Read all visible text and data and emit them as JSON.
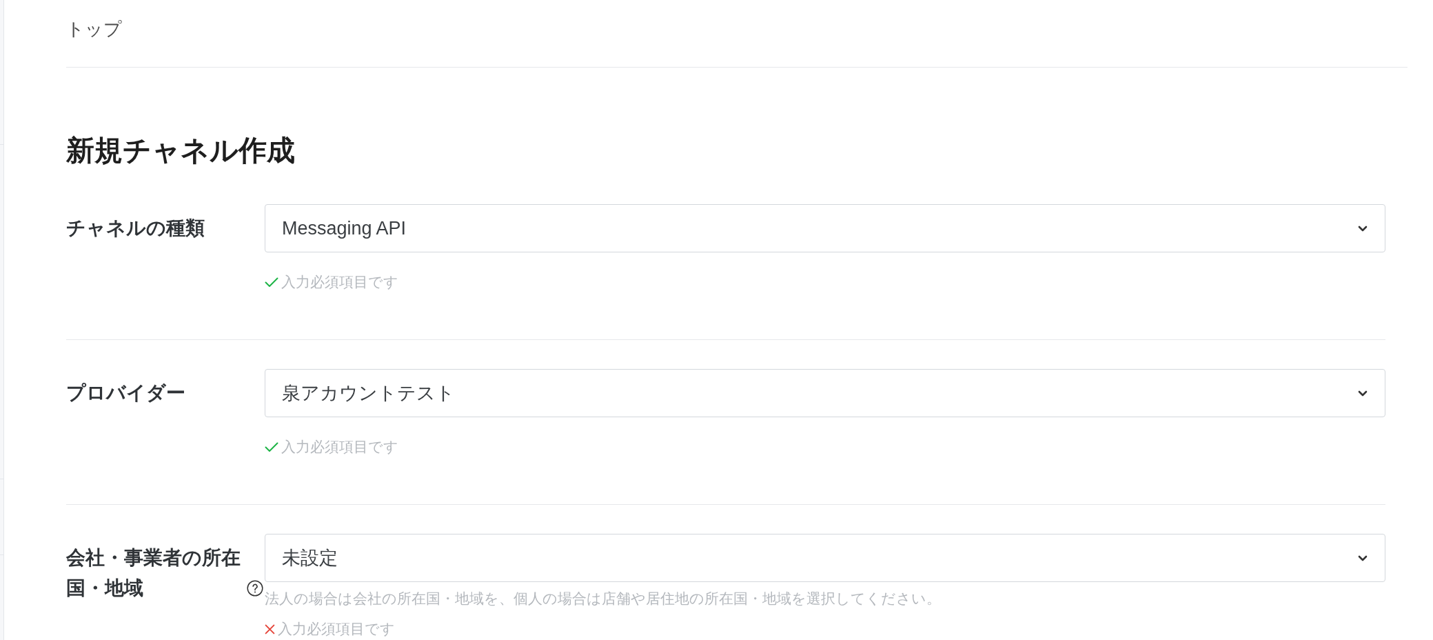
{
  "breadcrumb": {
    "label": "トップ"
  },
  "title": "新規チャネル作成",
  "fields": [
    {
      "label": "チャネルの種類",
      "value": "Messaging API",
      "valid": true,
      "message": "入力必須項目です"
    },
    {
      "label": "プロバイダー",
      "value": "泉アカウントテスト",
      "valid": true,
      "message": "入力必須項目です"
    },
    {
      "label": "会社・事業者の所在国・地域",
      "help": true,
      "value": "未設定",
      "description": "法人の場合は会社の所在国・地域を、個人の場合は店舗や居住地の所在国・地域を選択してください。",
      "valid": false,
      "message": "入力必須項目です"
    }
  ]
}
